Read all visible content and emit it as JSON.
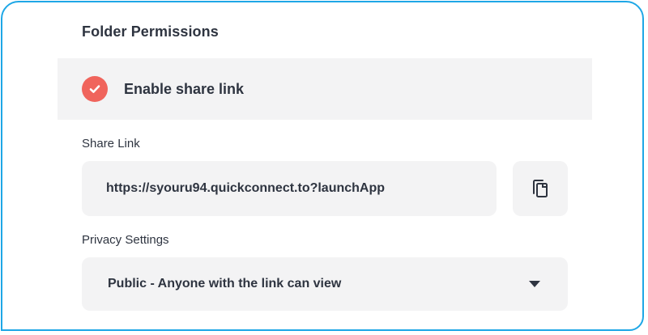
{
  "title": "Folder Permissions",
  "share_toggle": {
    "label": "Enable share link",
    "checked": true,
    "icon": "check-circle-icon",
    "color": "#f0645c"
  },
  "share_link": {
    "label": "Share Link",
    "value": "https://syouru94.quickconnect.to?launchApp",
    "copy_icon": "copy-icon"
  },
  "privacy": {
    "label": "Privacy Settings",
    "selected": "Public - Anyone with the link can view",
    "dropdown_icon": "caret-down-icon"
  },
  "colors": {
    "border": "#1ea7e6",
    "panel": "#f3f3f4",
    "text": "#2e3440",
    "accent": "#f0645c"
  }
}
